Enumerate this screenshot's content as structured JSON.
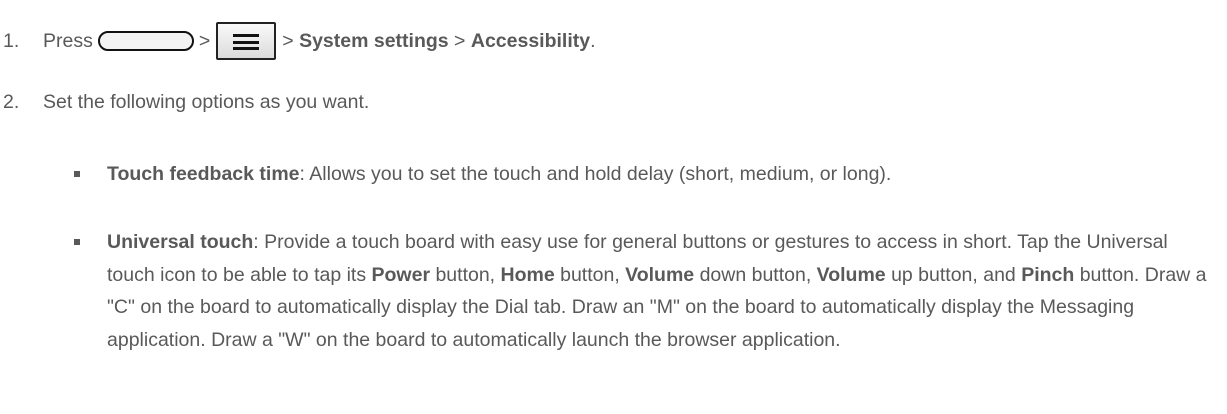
{
  "step1": {
    "number": "1.",
    "press": "Press",
    "sep1": ">",
    "sep2": ">",
    "system_settings": "System settings",
    "sep3": ">",
    "accessibility": "Accessibility",
    "end": "."
  },
  "step2": {
    "number": "2.",
    "text": "Set the following options as you want."
  },
  "bullets": [
    {
      "term": "Touch feedback time",
      "text": ": Allows you to set the touch and hold delay (short, medium, or long)."
    },
    {
      "term": "Universal touch",
      "t1": ": Provide a touch board with easy use for general buttons or gestures to access in short. Tap the Universal touch icon to be able to tap its ",
      "power": "Power",
      "t2": " button, ",
      "home": "Home",
      "t3": " button, ",
      "volume1": "Volume",
      "t4": " down button, ",
      "volume2": "Volume",
      "t5": " up button, and ",
      "pinch": "Pinch",
      "t6": " button. Draw a \"C\" on the board to automatically display the Dial tab. Draw an \"M\" on the board to automatically display the Messaging application. Draw a \"W\" on the board to automatically launch the browser application."
    }
  ],
  "icons": {
    "home_button": "home-key-icon",
    "menu_button": "menu-key-icon"
  }
}
